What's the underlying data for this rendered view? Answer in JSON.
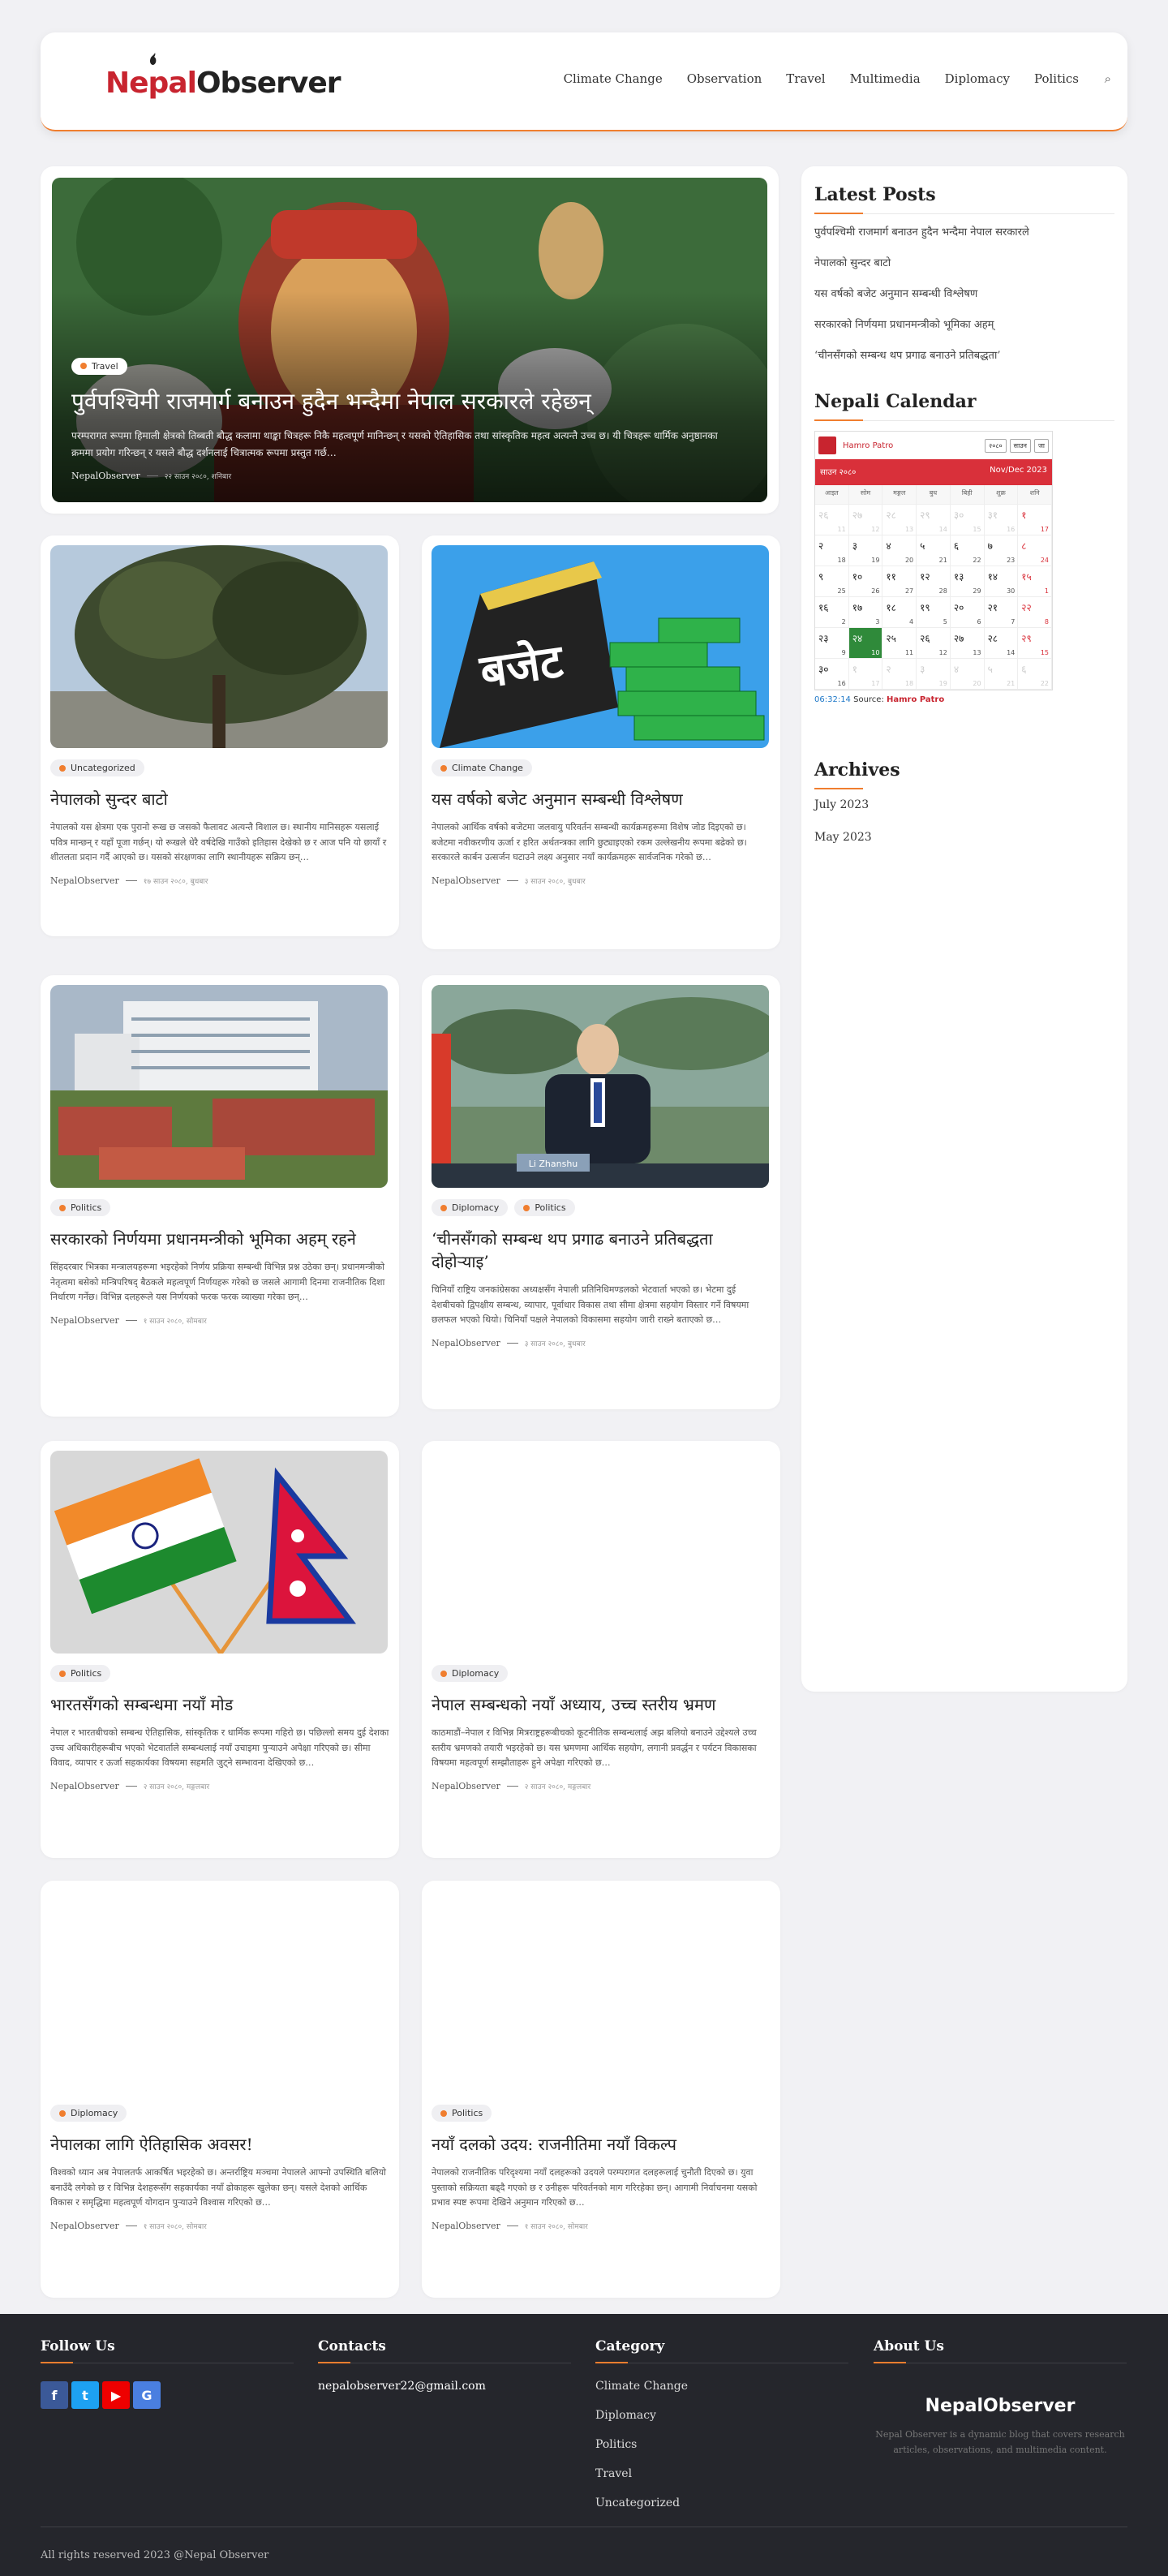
{
  "header": {
    "logo_a": "Nepal",
    "logo_b": "Observer",
    "nav": [
      "Climate Change",
      "Observation",
      "Travel",
      "Multimedia",
      "Diplomacy",
      "Politics"
    ]
  },
  "hero": {
    "tag": "Travel",
    "title": "पुर्वपश्चिमी राजमार्ग बनाउन हुदैन भन्दैमा नेपाल सरकारले रहेछन्",
    "excerpt": "परम्परागत रूपमा हिमाली क्षेत्रको तिब्बती बौद्ध कलामा थाङ्का चित्रहरू निकै महत्वपूर्ण मानिन्छन् र यसको ऐतिहासिक तथा सांस्कृतिक महत्व अत्यन्तै उच्च छ। यी चित्रहरू धार्मिक अनुष्ठानका क्रममा प्रयोग गरिन्छन् र यसले बौद्ध दर्शनलाई चित्रात्मक रूपमा प्रस्तुत गर्छ…",
    "author": "NepalObserver",
    "date": "२२ साउन २०८०, शनिबार"
  },
  "posts": [
    {
      "tags": [
        "Uncategorized"
      ],
      "title": "नेपालको सुन्दर बाटो",
      "excerpt": "नेपालको यस क्षेत्रमा एक पुरानो रूख छ जसको फैलावट अत्यन्तै विशाल छ। स्थानीय मानिसहरू यसलाई पवित्र मान्छन् र यहाँ पूजा गर्छन्। यो रूखले धेरै वर्षदेखि गाउँको इतिहास देखेको छ र आज पनि यो छायाँ र शीतलता प्रदान गर्दै आएको छ। यसको संरक्षणका लागि स्थानीयहरू सक्रिय छन्…",
      "author": "NepalObserver",
      "date": "१७ साउन २०८०, बुधबार"
    },
    {
      "tags": [
        "Climate Change"
      ],
      "title": "यस वर्षको बजेट अनुमान सम्बन्धी विश्लेषण",
      "excerpt": "नेपालको आर्थिक वर्षको बजेटमा जलवायु परिवर्तन सम्बन्धी कार्यक्रमहरूमा विशेष जोड दिइएको छ। बजेटमा नवीकरणीय ऊर्जा र हरित अर्थतन्त्रका लागि छुट्याइएको रकम उल्लेखनीय रूपमा बढेको छ। सरकारले कार्बन उत्सर्जन घटाउने लक्ष्य अनुसार नयाँ कार्यक्रमहरू सार्वजनिक गरेको छ…",
      "author": "NepalObserver",
      "date": "३ साउन २०८०, बुधबार"
    },
    {
      "tags": [
        "Politics"
      ],
      "title": "सरकारको निर्णयमा प्रधानमन्त्रीको भूमिका अहम् रहने",
      "excerpt": "सिंहदरबार भित्रका मन्त्रालयहरूमा भइरहेको निर्णय प्रक्रिया सम्बन्धी विभिन्न प्रश्न उठेका छन्। प्रधानमन्त्रीको नेतृत्वमा बसेको मन्त्रिपरिषद् बैठकले महत्वपूर्ण निर्णयहरू गरेको छ जसले आगामी दिनमा राजनीतिक दिशा निर्धारण गर्नेछ। विभिन्न दलहरूले यस निर्णयको फरक फरक व्याख्या गरेका छन्…",
      "author": "NepalObserver",
      "date": "१ साउन २०८०, सोमबार"
    },
    {
      "tags": [
        "Diplomacy",
        "Politics"
      ],
      "title": "‘चीनसँगको सम्बन्ध थप प्रगाढ बनाउने प्रतिबद्धता दोहोर्‍याइ’",
      "excerpt": "चिनियाँ राष्ट्रिय जनकांग्रेसका अध्यक्षसँग नेपाली प्रतिनिधिमण्डलको भेटवार्ता भएको छ। भेटमा दुई देशबीचको द्विपक्षीय सम्बन्ध, व्यापार, पूर्वाधार विकास तथा सीमा क्षेत्रमा सहयोग विस्तार गर्ने विषयमा छलफल भएको थियो। चिनियाँ पक्षले नेपालको विकासमा सहयोग जारी राख्ने बताएको छ…",
      "author": "NepalObserver",
      "date": "३ साउन २०८०, बुधबार"
    },
    {
      "tags": [
        "Politics"
      ],
      "title": "भारतसँगको सम्बन्धमा नयाँ मोड",
      "excerpt": "नेपाल र भारतबीचको सम्बन्ध ऐतिहासिक, सांस्कृतिक र धार्मिक रूपमा गहिरो छ। पछिल्लो समय दुई देशका उच्च अधिकारीहरूबीच भएको भेटवार्ताले सम्बन्धलाई नयाँ उचाइमा पुर्‍याउने अपेक्षा गरिएको छ। सीमा विवाद, व्यापार र ऊर्जा सहकार्यका विषयमा सहमति जुट्ने सम्भावना देखिएको छ…",
      "author": "NepalObserver",
      "date": "२ साउन २०८०, मङ्गलबार"
    },
    {
      "tags": [
        "Diplomacy"
      ],
      "title": "नेपाल सम्बन्धको नयाँ अध्याय, उच्च स्तरीय भ्रमण",
      "excerpt": "काठमाडौं–नेपाल र विभिन्न मित्रराष्ट्रहरूबीचको कूटनीतिक सम्बन्धलाई अझ बलियो बनाउने उद्देश्यले उच्च स्तरीय भ्रमणको तयारी भइरहेको छ। यस भ्रमणमा आर्थिक सहयोग, लगानी प्रवर्द्धन र पर्यटन विकासका विषयमा महत्वपूर्ण सम्झौताहरू हुने अपेक्षा गरिएको छ…",
      "author": "NepalObserver",
      "date": "२ साउन २०८०, मङ्गलबार"
    },
    {
      "tags": [
        "Diplomacy"
      ],
      "title": "नेपालका लागि ऐतिहासिक अवसर!",
      "excerpt": "विश्वको ध्यान अब नेपालतर्फ आकर्षित भइरहेको छ। अन्तर्राष्ट्रिय मञ्चमा नेपालले आफ्नो उपस्थिति बलियो बनाउँदै लगेको छ र विभिन्न देशहरूसँग सहकार्यका नयाँ ढोकाहरू खुलेका छन्। यसले देशको आर्थिक विकास र समृद्धिमा महत्वपूर्ण योगदान पुर्‍याउने विश्वास गरिएको छ…",
      "author": "NepalObserver",
      "date": "१ साउन २०८०, सोमबार"
    },
    {
      "tags": [
        "Politics"
      ],
      "title": "नयाँ दलको उदय: राजनीतिमा नयाँ विकल्प",
      "excerpt": "नेपालको राजनीतिक परिदृश्यमा नयाँ दलहरूको उदयले परम्परागत दलहरूलाई चुनौती दिएको छ। युवा पुस्ताको सक्रियता बढ्दै गएको छ र उनीहरू परिवर्तनको माग गरिरहेका छन्। आगामी निर्वाचनमा यसको प्रभाव स्पष्ट रूपमा देखिने अनुमान गरिएको छ…",
      "author": "NepalObserver",
      "date": "१ साउन २०८०, सोमबार"
    }
  ],
  "sidebar": {
    "latest_title": "Latest Posts",
    "latest": [
      "पुर्वपश्चिमी राजमार्ग बनाउन हुदैन भन्दैमा नेपाल सरकारले",
      "नेपालको सुन्दर बाटो",
      "यस वर्षको बजेट अनुमान सम्बन्धी विश्लेषण",
      "सरकारको निर्णयमा प्रधानमन्त्रीको भूमिका अहम्",
      "‘चीनसँगको सम्बन्ध थप प्रगाढ बनाउने प्रतिबद्धता’"
    ],
    "calendar_title": "Nepali Calendar",
    "calendar": {
      "brand": "Hamro Patro",
      "sel_year": "२०८०",
      "sel_month": "साउन",
      "go": "जा",
      "month_np": "साउन २०८०",
      "month_en": "Nov/Dec 2023",
      "weekdays": [
        "आइत",
        "सोम",
        "मङ्गल",
        "बुध",
        "बिही",
        "शुक्र",
        "शनि"
      ],
      "time": "06:32:14",
      "source_label": "Source:",
      "source_name": "Hamro Patro"
    },
    "archives_title": "Archives",
    "archives": [
      "July 2023",
      "May 2023"
    ]
  },
  "footer": {
    "follow": "Follow Us",
    "contacts": "Contacts",
    "email": "nepalobserver22@gmail.com",
    "category": "Category",
    "categories": [
      "Climate Change",
      "Diplomacy",
      "Politics",
      "Travel",
      "Uncategorized"
    ],
    "about": "About Us",
    "about_logo": "NepalObserver",
    "about_text": "Nepal Observer is a dynamic blog that covers research articles, observations, and multimedia content.",
    "copyright": "All rights reserved 2023 @Nepal Observer"
  },
  "colors": {
    "accent": "#f07e2f",
    "brand_red": "#c8242f",
    "footer_bg": "#25262c"
  }
}
